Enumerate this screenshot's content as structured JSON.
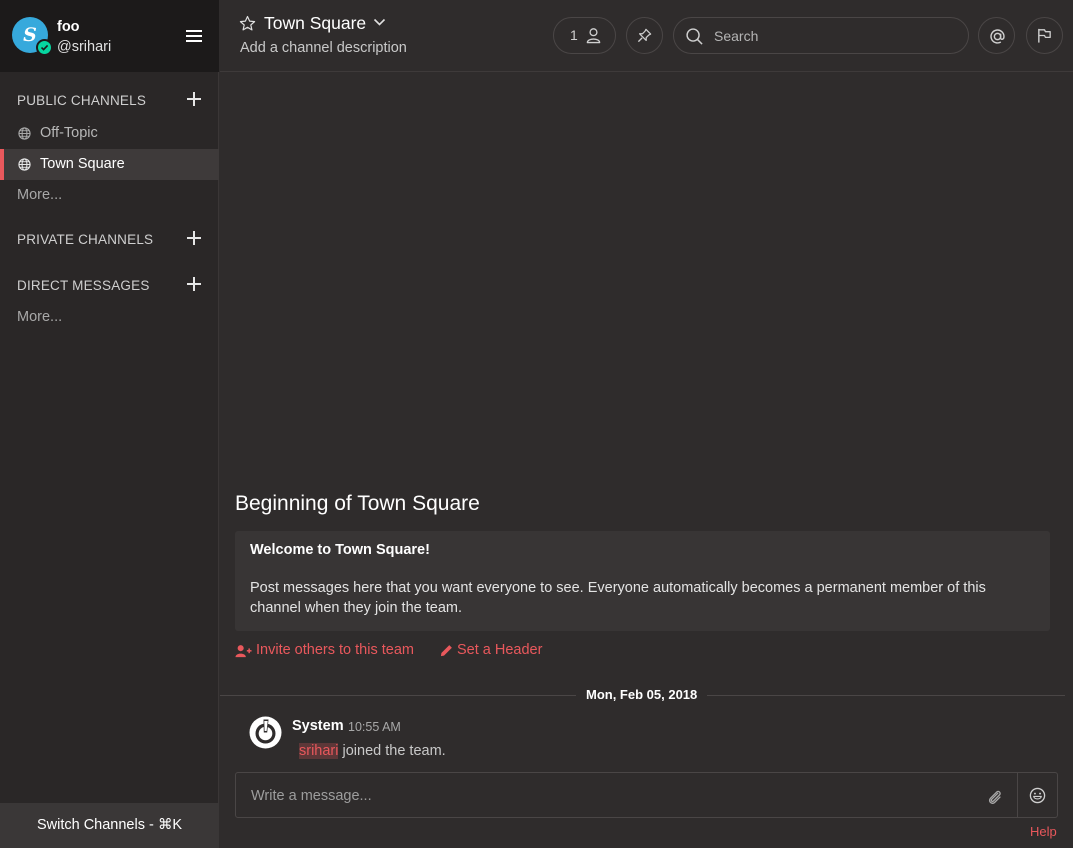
{
  "sidebar": {
    "avatar_letter": "S",
    "team_name": "foo",
    "username": "@srihari",
    "sections": [
      {
        "label": "PUBLIC CHANNELS"
      },
      {
        "label": "PRIVATE CHANNELS"
      },
      {
        "label": "DIRECT MESSAGES"
      }
    ],
    "public_channels": [
      {
        "name": "Off-Topic",
        "active": false
      },
      {
        "name": "Town Square",
        "active": true
      }
    ],
    "public_more": "More...",
    "direct_more": "More...",
    "switch_channels": "Switch Channels - ⌘K"
  },
  "header": {
    "channel_name": "Town Square",
    "description": "Add a channel description",
    "member_count": "1",
    "search_placeholder": "Search"
  },
  "intro": {
    "title": "Beginning of Town Square",
    "welcome": "Welcome to Town Square!",
    "body": "Post messages here that you want everyone to see. Everyone automatically becomes a permanent member of this channel when they join the team.",
    "invite_action": "Invite others to this team",
    "header_action": "Set a Header"
  },
  "date_separator": "Mon, Feb 05, 2018",
  "post": {
    "author": "System",
    "time": "10:55 AM",
    "mention": "srihari",
    "text": " joined the team."
  },
  "composer": {
    "placeholder": "Write a message...",
    "help": "Help"
  },
  "colors": {
    "accent": "#e9585c",
    "sidebar_bg": "#2a2727",
    "header_bg": "#1c1a1a",
    "center_bg": "#2f2c2c",
    "status_online": "#06d6a0",
    "avatar_bg": "#36a9dc"
  },
  "icons": {
    "star": "star-icon",
    "member": "member-icon",
    "pin": "pin-icon",
    "search": "search-icon",
    "mention": "at-icon",
    "flag": "flag-icon",
    "globe": "globe-icon",
    "attach": "paperclip-icon",
    "emoji": "emoji-icon"
  }
}
